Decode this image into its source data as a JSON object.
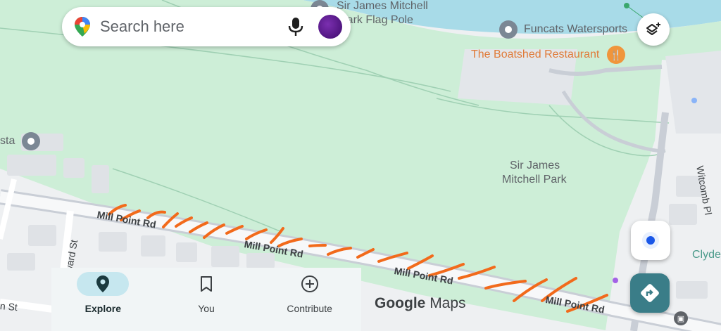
{
  "search": {
    "placeholder": "Search here"
  },
  "map": {
    "pois": [
      {
        "name": "Sir James Mitchell\nPark Flag Pole",
        "line1": "Sir James Mitchell",
        "line2": "Park Flag Pole"
      },
      {
        "name": "Funcats Watersports"
      },
      {
        "name": "The Boatshed Restaurant",
        "color": "#e07b39"
      },
      {
        "name": "sta"
      }
    ],
    "park_label_line1": "Sir James",
    "park_label_line2": "Mitchell Park",
    "roads": {
      "mill_point_1": "Mill Point Rd",
      "mill_point_2": "Mill Point Rd",
      "mill_point_3": "Mill Point Rd",
      "mill_point_4": "Mill Point Rd",
      "ward_st": "ward St",
      "n_st": "n St",
      "witcomb_pl": "Witcomb Pl",
      "clyde": "Clyde"
    }
  },
  "bottom_nav": {
    "items": [
      {
        "label": "Explore",
        "icon": "location-pin-icon",
        "active": true
      },
      {
        "label": "You",
        "icon": "bookmark-icon",
        "active": false
      },
      {
        "label": "Contribute",
        "icon": "add-circle-icon",
        "active": false
      }
    ]
  },
  "wordmark": {
    "google": "Google",
    "maps": "Maps"
  },
  "colors": {
    "park": "#cdeed7",
    "water": "#a8dbe8",
    "road": "#ffffff",
    "annotation": "#f26a1b",
    "accent": "#3a7d88"
  }
}
